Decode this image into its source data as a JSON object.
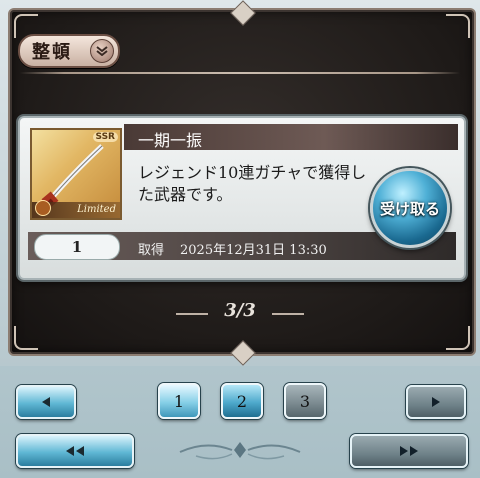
{
  "toolbar": {
    "sort_label": "整頓"
  },
  "item": {
    "name": "一期一振",
    "rarity": "SSR",
    "limited_label": "Limited",
    "description": "レジェンド10連ガチャで獲得した武器です。",
    "quantity": "1",
    "received_label": "取得",
    "received_date": "2025年12月31日 13:30",
    "claim_label": "受け取る"
  },
  "pager": {
    "indicator": "3/3",
    "pages": [
      "1",
      "2",
      "3"
    ],
    "current_page": "3"
  },
  "colors": {
    "accent_blue": "#4fb0d6",
    "panel_dark": "#1e1a18"
  },
  "icons": {
    "prev": "triangle-left-icon",
    "next": "triangle-right-icon",
    "first": "double-triangle-left-icon",
    "last": "double-triangle-right-icon",
    "sort": "chevron-down-icon"
  }
}
